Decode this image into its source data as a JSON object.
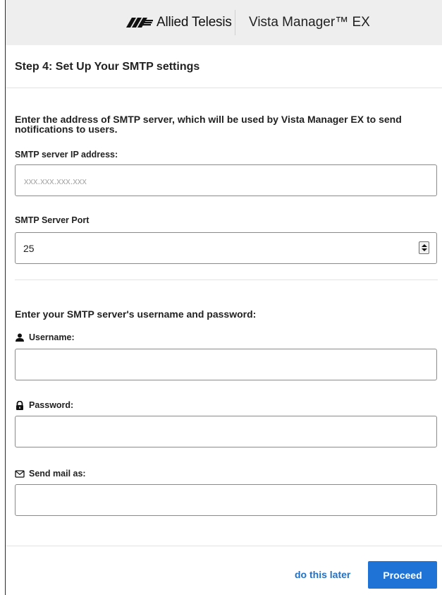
{
  "header": {
    "brand": "Allied Telesis",
    "product": "Vista Manager™ EX"
  },
  "step": {
    "title": "Step 4: Set Up Your SMTP settings"
  },
  "server_section": {
    "description": "Enter the address of SMTP server, which will be used by Vista Manager EX to send notifications to users.",
    "ip_label": "SMTP server IP address:",
    "ip_placeholder": "xxx.xxx.xxx.xxx",
    "ip_value": "",
    "port_label": "SMTP Server Port",
    "port_value": "25"
  },
  "auth_section": {
    "description": "Enter your SMTP server's username and password:",
    "username_label": "Username:",
    "username_value": "",
    "password_label": "Password:",
    "password_value": "",
    "sendas_label": "Send mail as:",
    "sendas_value": ""
  },
  "footer": {
    "later_label": "do this later",
    "proceed_label": "Proceed"
  },
  "colors": {
    "accent": "#1f73d6",
    "link": "#2272c9",
    "header_bg": "#eeeeee"
  },
  "icons": {
    "logo": "allied-telesis-logo",
    "username": "person-icon",
    "password": "lock-icon",
    "sendas": "envelope-icon",
    "port_stepper": "spinner-icon"
  }
}
